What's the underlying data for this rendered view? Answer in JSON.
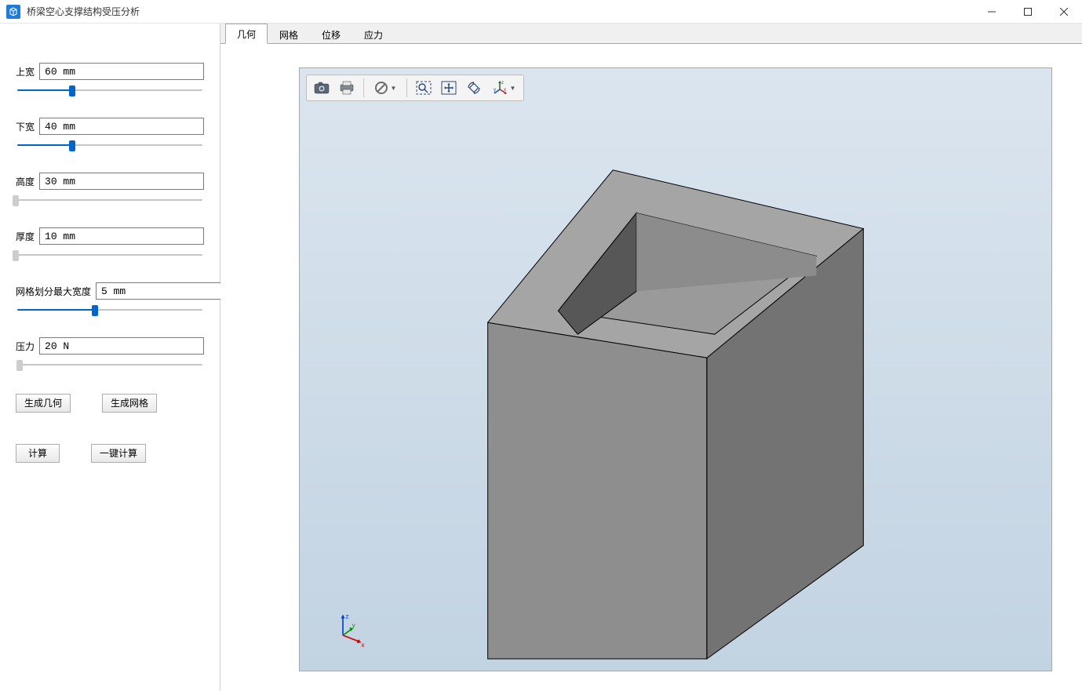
{
  "window": {
    "title": "桥梁空心支撑结构受压分析"
  },
  "sidebar": {
    "params": [
      {
        "label": "上宽",
        "value": "60 mm",
        "fillPct": 30,
        "thumbGray": false
      },
      {
        "label": "下宽",
        "value": "40 mm",
        "fillPct": 30,
        "thumbGray": false
      },
      {
        "label": "高度",
        "value": "30 mm",
        "fillPct": 0,
        "thumbGray": true
      },
      {
        "label": "厚度",
        "value": "10 mm",
        "fillPct": 0,
        "thumbGray": true
      },
      {
        "label": "网格划分最大宽度",
        "value": "5 mm",
        "fillPct": 42,
        "thumbGray": false
      },
      {
        "label": "压力",
        "value": "20 N",
        "fillPct": 2,
        "thumbGray": true
      }
    ],
    "buttons": {
      "gen_geom": "生成几何",
      "gen_mesh": "生成网格",
      "compute": "计算",
      "one_click": "一键计算"
    }
  },
  "tabs": {
    "items": [
      "几何",
      "网格",
      "位移",
      "应力"
    ],
    "activeIndex": 0
  },
  "axis": {
    "x": "x",
    "y": "y",
    "z": "z"
  }
}
